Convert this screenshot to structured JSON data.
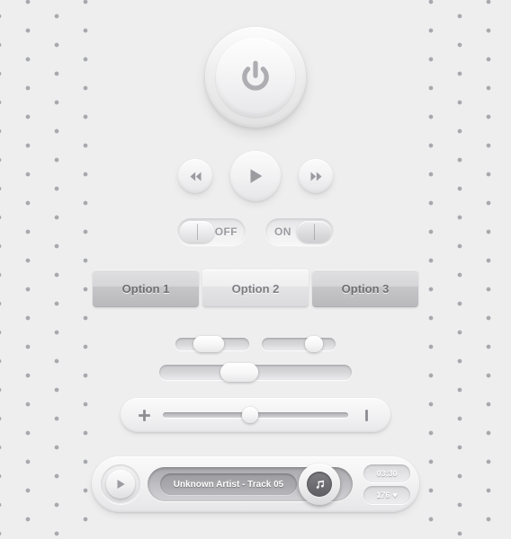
{
  "theme": {
    "background": "#eeeeef",
    "dot_color": "#a8a9ad",
    "text_gray": "#6e6e73",
    "accent_gray": "#8d8d92"
  },
  "power": {
    "icon": "power-icon",
    "label": "Power"
  },
  "media_controls": {
    "buttons": [
      {
        "name": "rewind-button",
        "icon": "rewind-icon",
        "label": "Rewind"
      },
      {
        "name": "play-button",
        "icon": "play-icon",
        "label": "Play"
      },
      {
        "name": "forward-button",
        "icon": "fast-forward-icon",
        "label": "Fast Forward"
      }
    ]
  },
  "toggles": [
    {
      "name": "toggle-off",
      "label": "OFF",
      "state": "off"
    },
    {
      "name": "toggle-on",
      "label": "ON",
      "state": "on"
    }
  ],
  "options": [
    {
      "label": "Option 1",
      "style": "dark"
    },
    {
      "label": "Option 2",
      "style": "light"
    },
    {
      "label": "Option 3",
      "style": "dark"
    }
  ],
  "sliders": [
    {
      "name": "slider-small-1",
      "value": 35
    },
    {
      "name": "slider-small-2",
      "value": 65
    },
    {
      "name": "slider-wide",
      "value": 40
    }
  ],
  "volume": {
    "left_icon": "plus-icon",
    "right_icon": "bar-icon",
    "value": 47
  },
  "player": {
    "play_icon": "play-icon",
    "track_title": "Unknown Artist - Track 05",
    "handle_icon": "music-note-icon",
    "badges": [
      {
        "name": "time-badge",
        "value": "03:30",
        "icon": null
      },
      {
        "name": "likes-badge",
        "value": "176",
        "icon": "heart-icon",
        "icon_glyph": "♥"
      }
    ]
  }
}
